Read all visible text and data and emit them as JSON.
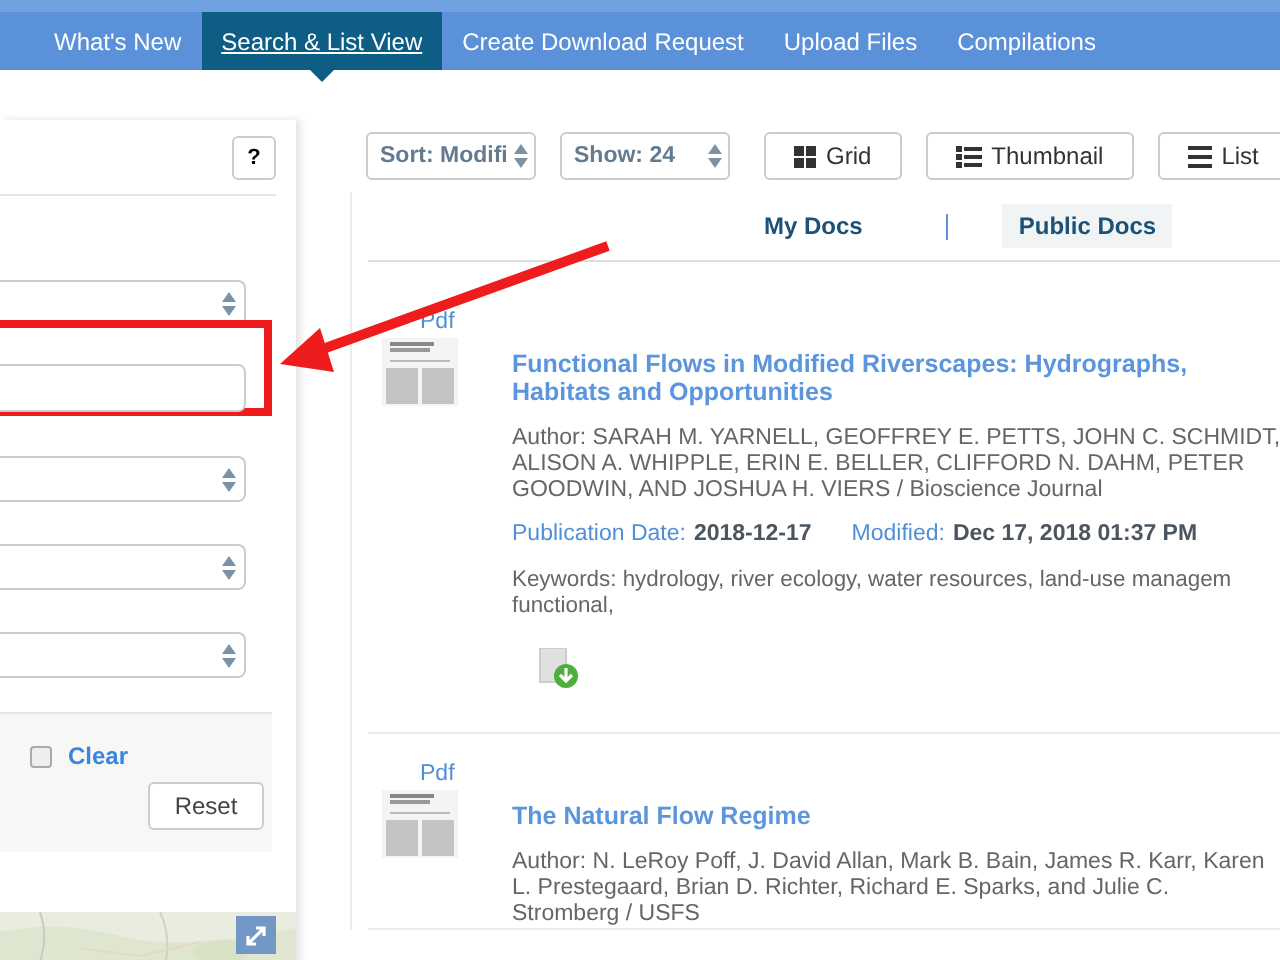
{
  "nav": {
    "tabs": [
      {
        "label": "What's New",
        "selected": false
      },
      {
        "label": "Search & List View",
        "selected": true
      },
      {
        "label": "Create Download Request",
        "selected": false
      },
      {
        "label": "Upload Files",
        "selected": false
      },
      {
        "label": "Compilations",
        "selected": false
      }
    ]
  },
  "filter_panel": {
    "help_button": "?",
    "fields": [
      {
        "kind": "select",
        "highlighted": false
      },
      {
        "kind": "input",
        "highlighted": true
      },
      {
        "kind": "select",
        "highlighted": false
      },
      {
        "kind": "select",
        "highlighted": false
      },
      {
        "kind": "select",
        "highlighted": false
      }
    ],
    "clear": {
      "label": "Clear",
      "checked": false
    },
    "reset_button": "Reset"
  },
  "toolbar": {
    "sort": "Sort: Modifi",
    "show": "Show: 24",
    "views": [
      {
        "label": "Grid",
        "kind": "grid"
      },
      {
        "label": "Thumbnail",
        "kind": "thumbnail"
      },
      {
        "label": "List",
        "kind": "list"
      }
    ]
  },
  "doc_tabs": [
    {
      "label": "My Docs",
      "selected": false
    },
    {
      "label": "Public Docs",
      "selected": true
    }
  ],
  "documents": [
    {
      "file_type": "Pdf",
      "title": "Functional Flows in Modified Riverscapes: Hydrographs, Habitats and Opportunities",
      "author": "Author: SARAH M. YARNELL, GEOFFREY E. PETTS, JOHN C. SCHMIDT, ALISON A. WHIPPLE, ERIN E. BELLER, CLIFFORD N. DAHM, PETER GOODWIN, AND JOSHUA H. VIERS / Bioscience Journal",
      "publication_label": "Publication Date:",
      "publication_date": "2018-12-17",
      "modified_label": "Modified:",
      "modified": "Dec 17, 2018 01:37 PM",
      "keyword_lines": [
        "Keywords: hydrology, river ecology, water resources, land-use managem",
        "functional,"
      ],
      "download": true
    },
    {
      "file_type": "Pdf",
      "title": "The Natural Flow Regime",
      "author": "Author: N. LeRoy Poff, J. David Allan, Mark B. Bain, James R. Karr, Karen L. Prestegaard, Brian D. Richter, Richard E. Sparks, and Julie C. Stromberg / USFS",
      "download": false
    }
  ],
  "annotation": {
    "kind": "arrow"
  }
}
